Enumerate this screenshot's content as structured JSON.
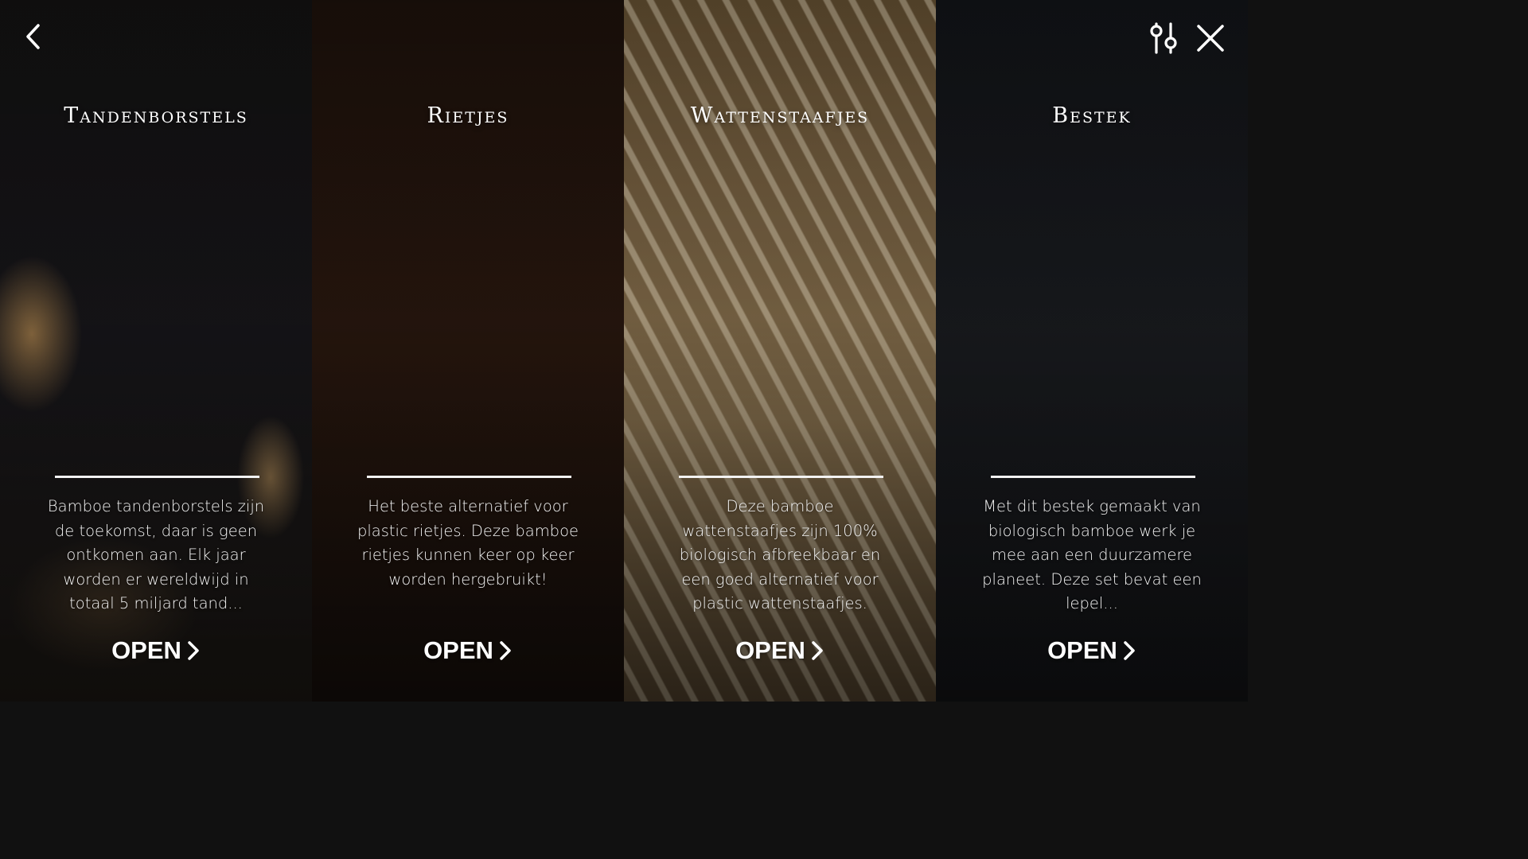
{
  "toolbar": {
    "back_icon": "chevron-left-icon",
    "filter_icon": "sliders-icon",
    "close_icon": "close-icon"
  },
  "panels": [
    {
      "title": "Tandenborstels",
      "description": "Bamboe tandenborstels zijn de toekomst, daar is geen ontkomen aan. Elk jaar worden er wereldwijd in totaal 5 miljard tand...",
      "open_label": "OPEN"
    },
    {
      "title": "Rietjes",
      "description": "Het beste alternatief voor plastic rietjes. Deze bamboe rietjes kunnen keer op keer worden hergebruikt!",
      "open_label": "OPEN"
    },
    {
      "title": "Wattenstaafjes",
      "description": "Deze bamboe wattenstaafjes zijn 100% biologisch afbreekbaar en een goed alternatief voor plastic wattenstaafjes.",
      "open_label": "OPEN"
    },
    {
      "title": "Bestek",
      "description": "Met dit bestek gemaakt van biologisch bamboe werk je mee aan een duurzamere planeet. Deze set bevat een lepel...",
      "open_label": "OPEN"
    }
  ],
  "colors": {
    "text": "#ffffff",
    "divider": "#f2f2f2"
  }
}
